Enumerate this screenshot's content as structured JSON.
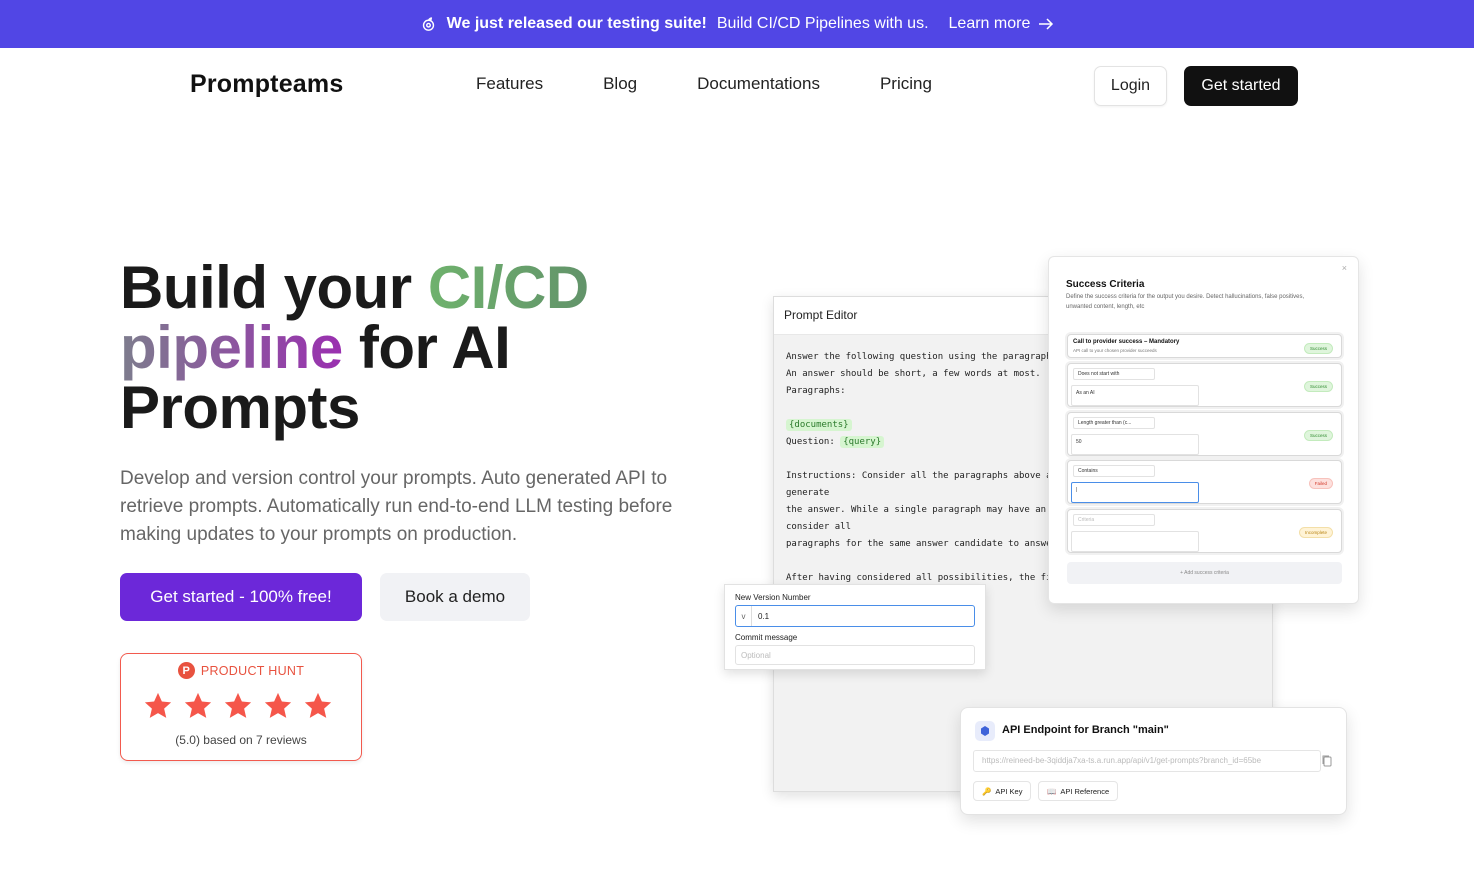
{
  "banner": {
    "bold": "We just released our testing suite!",
    "text": "Build CI/CD Pipelines with us.",
    "link": "Learn more"
  },
  "nav": {
    "logo": "Prompteams",
    "links": [
      "Features",
      "Blog",
      "Documentations",
      "Pricing"
    ],
    "login": "Login",
    "get_started": "Get started"
  },
  "hero": {
    "title_part1": "Build your ",
    "title_green": "CI/CD",
    "title_purple": "pipeline",
    "title_part2": " for AI",
    "title_part3": "Prompts",
    "subtitle": "Develop and version control your prompts. Auto generated API to retrieve prompts. Automatically run end-to-end LLM testing before making updates to your prompts on production.",
    "cta_primary": "Get started - 100% free!",
    "cta_secondary": "Book a demo"
  },
  "product_hunt": {
    "label": "PRODUCT HUNT",
    "logo_letter": "P",
    "stars": 5,
    "reviews": "(5.0) based on 7 reviews"
  },
  "prompt_editor": {
    "title": "Prompt Editor",
    "lines": [
      "Answer the following question using the paragraphs",
      "An answer should be short, a few words at most.",
      "Paragraphs:",
      "",
      "{documents}",
      "Question: {query}",
      "",
      "Instructions: Consider all the paragraphs above and",
      "generate",
      "the answer. While a single paragraph may have an",
      "consider all",
      "paragraphs for the same answer candidate to answer",
      "",
      "After having considered all possibilities, the final"
    ],
    "tag_documents": "{documents}",
    "tag_query": "{query}",
    "question_label": "Question: "
  },
  "version": {
    "number_label": "New Version Number",
    "prefix": "v",
    "number_value": "0.1",
    "commit_label": "Commit message",
    "commit_placeholder": "Optional"
  },
  "criteria": {
    "title": "Success Criteria",
    "description": "Define the success criteria for the output you desire. Detect hallucinations, false positives, unwanted content, length, etc",
    "close": "×",
    "rows": [
      {
        "title": "Call to provider success – Mandatory",
        "sub": "API call to your chosen provider succeeds",
        "badge": "Success"
      },
      {
        "select": "Does not start with",
        "value": "As an AI",
        "badge": "Success"
      },
      {
        "select": "Length greater than (c...",
        "value": "50",
        "badge": "Success"
      },
      {
        "select": "Contains",
        "value": "|",
        "badge": "Failed"
      },
      {
        "select": "Criteria",
        "value": "",
        "badge": "Incomplete"
      }
    ],
    "add_label": "+ Add success criteria"
  },
  "api": {
    "title": "API Endpoint for Branch \"main\"",
    "url": "https://reineed-be-3qiddja7xa-ts.a.run.app/api/v1/get-prompts?branch_id=65be",
    "api_key": "API Key",
    "api_reference": "API Reference"
  },
  "colors": {
    "banner": "#5146e5",
    "cta": "#6c28d9",
    "product_hunt": "#e8523f"
  }
}
